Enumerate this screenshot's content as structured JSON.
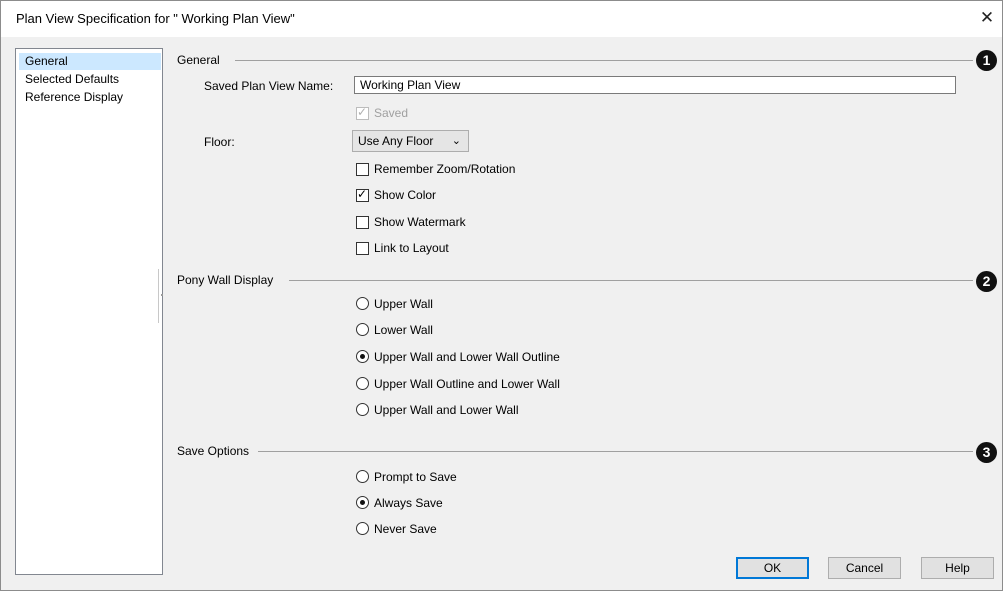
{
  "window": {
    "title": "Plan View Specification for \" Working Plan View\""
  },
  "sidebar": {
    "items": [
      {
        "label": "General",
        "selected": true
      },
      {
        "label": "Selected Defaults",
        "selected": false
      },
      {
        "label": "Reference Display",
        "selected": false
      }
    ]
  },
  "general": {
    "label": "General",
    "badge": "1",
    "name_label": "Saved Plan View Name:",
    "name_value": "Working Plan View",
    "saved_label": "Saved",
    "saved_checked": true,
    "floor_label": "Floor:",
    "floor_value": "Use Any Floor",
    "options": [
      {
        "label": "Remember Zoom/Rotation",
        "checked": false
      },
      {
        "label": "Show Color",
        "checked": true
      },
      {
        "label": "Show Watermark",
        "checked": false
      },
      {
        "label": "Link to Layout",
        "checked": false
      }
    ]
  },
  "pony_wall": {
    "label": "Pony Wall Display",
    "badge": "2",
    "options": [
      {
        "label": "Upper Wall",
        "selected": false
      },
      {
        "label": "Lower Wall",
        "selected": false
      },
      {
        "label": "Upper Wall and Lower Wall Outline",
        "selected": true
      },
      {
        "label": "Upper Wall Outline and Lower Wall",
        "selected": false
      },
      {
        "label": "Upper Wall and Lower Wall",
        "selected": false
      }
    ]
  },
  "save_options": {
    "label": "Save Options",
    "badge": "3",
    "options": [
      {
        "label": "Prompt to Save",
        "selected": false
      },
      {
        "label": "Always Save",
        "selected": true
      },
      {
        "label": "Never Save",
        "selected": false
      }
    ]
  },
  "buttons": {
    "ok": "OK",
    "cancel": "Cancel",
    "help": "Help"
  },
  "colors": {
    "accent": "#0078d7",
    "selection": "#cce8ff",
    "dialog_bg": "#f0f0f0"
  },
  "icons": {
    "close": "close-icon",
    "checkmark": "checkmark-icon",
    "chevron": "chevron-down-icon"
  }
}
